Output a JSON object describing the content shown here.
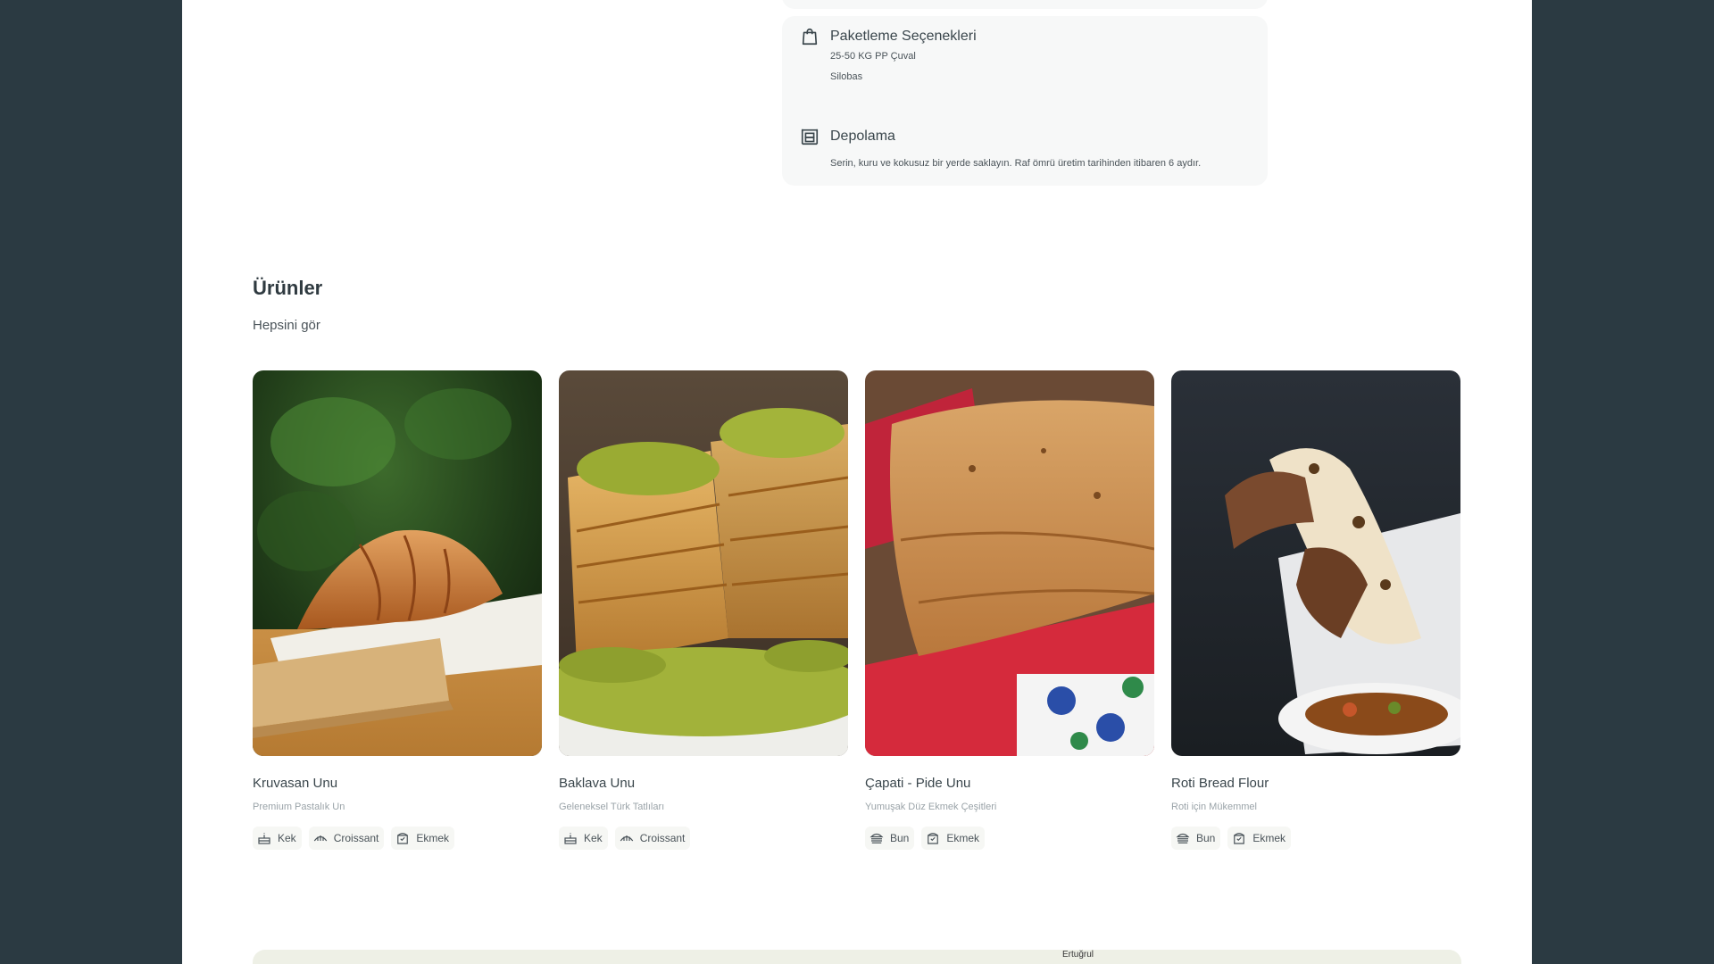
{
  "details": {
    "packaging": {
      "icon": "shopping-bag-icon",
      "title": "Paketleme Seçenekleri",
      "lines": [
        "25-50 KG PP Çuval",
        "Silobas"
      ]
    },
    "storage": {
      "icon": "warehouse-icon",
      "title": "Depolama",
      "text": "Serin, kuru ve kokusuz bir yerde saklayın. Raf ömrü üretim tarihinden itibaren 6 aydır."
    }
  },
  "products_section": {
    "title": "Ürünler",
    "see_all": "Hepsini gör",
    "items": [
      {
        "name": "Kruvasan Unu",
        "subtitle": "Premium Pastalık Un",
        "image": "croissant-photo",
        "tags": [
          {
            "label": "Kek",
            "icon": "cake-icon"
          },
          {
            "label": "Croissant",
            "icon": "croissant-icon"
          },
          {
            "label": "Ekmek",
            "icon": "bread-icon"
          }
        ]
      },
      {
        "name": "Baklava Unu",
        "subtitle": "Geleneksel Türk Tatlıları",
        "image": "baklava-photo",
        "tags": [
          {
            "label": "Kek",
            "icon": "cake-icon"
          },
          {
            "label": "Croissant",
            "icon": "croissant-icon"
          }
        ]
      },
      {
        "name": "Çapati - Pide Unu",
        "subtitle": "Yumuşak Düz Ekmek Çeşitleri",
        "image": "chapati-photo",
        "tags": [
          {
            "label": "Bun",
            "icon": "burger-bun-icon"
          },
          {
            "label": "Ekmek",
            "icon": "bread-icon"
          }
        ]
      },
      {
        "name": "Roti Bread Flour",
        "subtitle": "Roti için Mükemmel",
        "image": "roti-photo",
        "tags": [
          {
            "label": "Bun",
            "icon": "burger-bun-icon"
          },
          {
            "label": "Ekmek",
            "icon": "bread-icon"
          }
        ]
      }
    ]
  },
  "map": {
    "label": "Ertuğrul"
  },
  "colors": {
    "outer_background": "#2b3a42",
    "page_background": "#ffffff",
    "card_background": "#f7f8f8",
    "tag_background": "#f6f7f4"
  }
}
